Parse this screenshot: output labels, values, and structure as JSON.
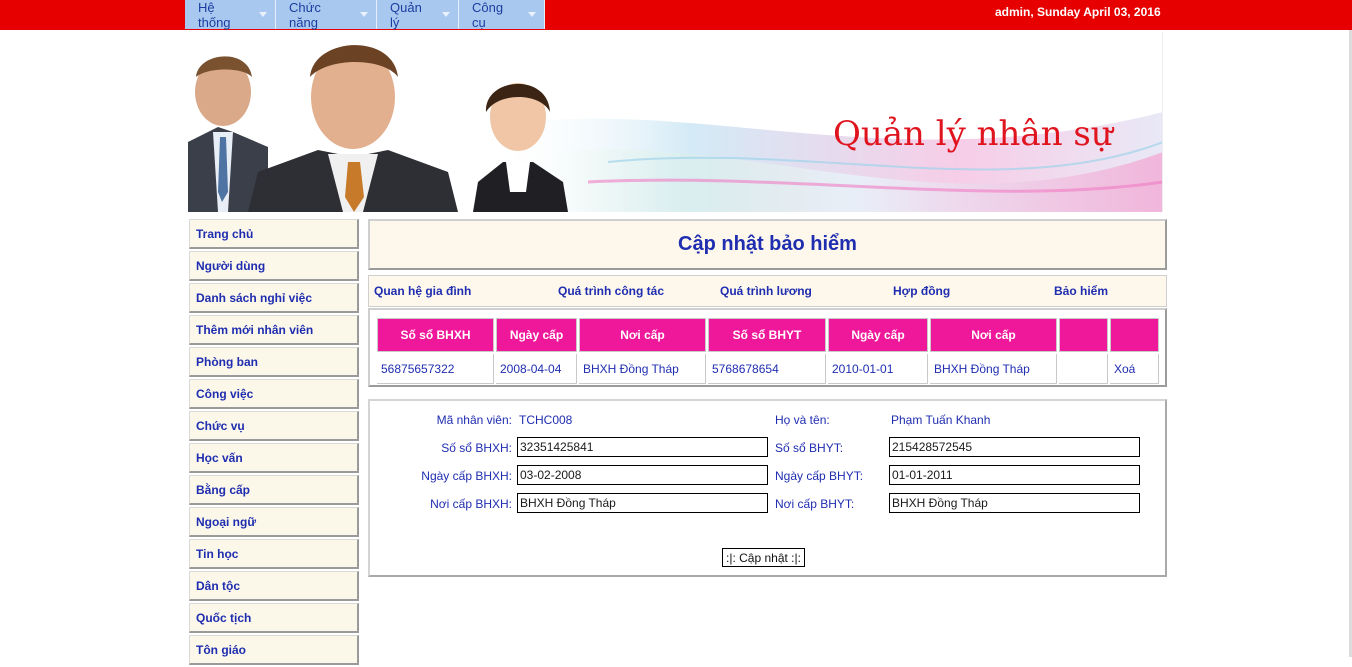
{
  "menu": [
    {
      "label": "Hệ thống"
    },
    {
      "label": "Chức năng"
    },
    {
      "label": "Quản lý"
    },
    {
      "label": "Công cụ"
    }
  ],
  "user_info": "admin, Sunday April 03, 2016",
  "banner": {
    "title": "Quản lý nhân sự"
  },
  "sidebar": [
    "Trang chủ",
    "Người dùng",
    "Danh sách nghỉ việc",
    "Thêm mới nhân viên",
    "Phòng ban",
    "Công việc",
    "Chức vụ",
    "Học vấn",
    "Bằng cấp",
    "Ngoại ngữ",
    "Tin học",
    "Dân tộc",
    "Quốc tịch",
    "Tôn giáo"
  ],
  "page_title": "Cập nhật bảo hiểm",
  "tabs": [
    "Quan hệ gia đình",
    "Quá trình công tác",
    "Quá trình lương",
    "Hợp đồng",
    "Bảo hiểm"
  ],
  "table": {
    "headers": [
      "Số sổ BHXH",
      "Ngày cấp",
      "Nơi cấp",
      "Số sổ BHYT",
      "Ngày cấp",
      "Nơi cấp",
      "",
      ""
    ],
    "rows": [
      [
        "56875657322",
        "2008-04-04",
        "BHXH Đồng Tháp",
        "5768678654",
        "2010-01-01",
        "BHXH Đồng Tháp",
        "",
        "Xoá"
      ]
    ]
  },
  "form": {
    "ma_nv_label": "Mã nhân viên:",
    "ma_nv_value": "TCHC008",
    "ho_ten_label": "Họ và tên:",
    "ho_ten_value": "Phạm Tuấn Khanh",
    "so_bhxh_label": "Số sổ BHXH:",
    "so_bhxh_value": "32351425841",
    "so_bhyt_label": "Số sổ BHYT:",
    "so_bhyt_value": "215428572545",
    "ngay_bhxh_label": "Ngày cấp BHXH:",
    "ngay_bhxh_value": "03-02-2008",
    "ngay_bhyt_label": "Ngày cấp BHYT:",
    "ngay_bhyt_value": "01-01-2011",
    "noi_bhxh_label": "Nơi cấp BHXH:",
    "noi_bhxh_value": "BHXH Đồng Tháp",
    "noi_bhyt_label": "Nơi cấp BHYT:",
    "noi_bhyt_value": "BHXH Đồng Tháp",
    "submit_label": ":|: Cập nhật :|:"
  },
  "colors": {
    "topbar": "#e60000",
    "menu": "#a9c8ef",
    "header_cell": "#f0189a",
    "link": "#1f2db0"
  }
}
